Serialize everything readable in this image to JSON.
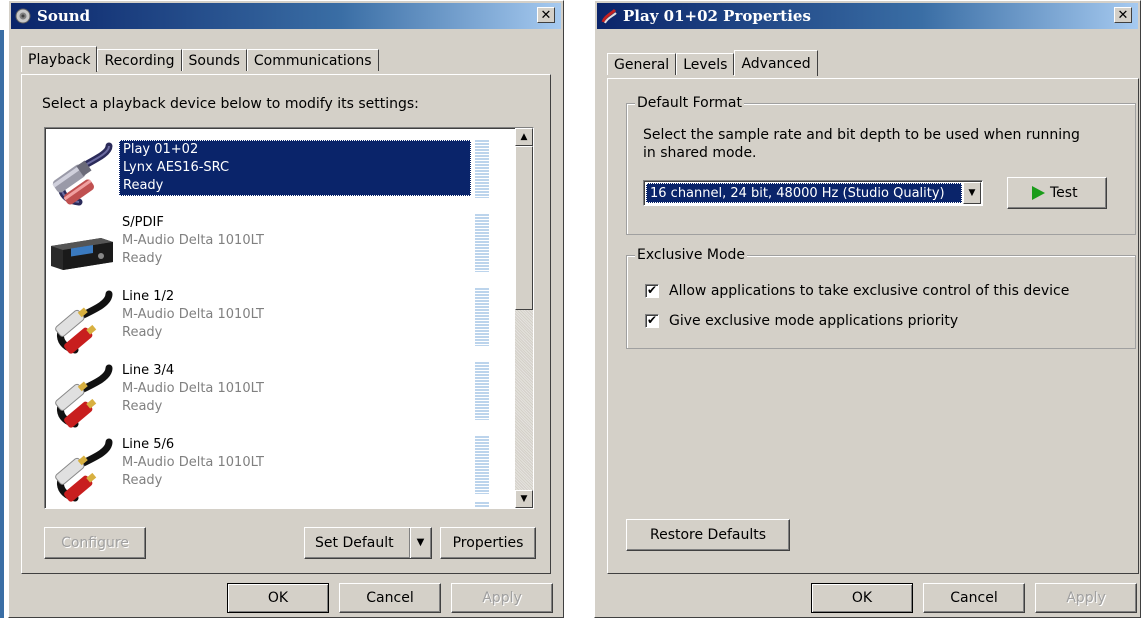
{
  "sound_dialog": {
    "title": "Sound",
    "close_glyph": "✕",
    "tabs": [
      {
        "label": "Playback",
        "active": true
      },
      {
        "label": "Recording",
        "active": false
      },
      {
        "label": "Sounds",
        "active": false
      },
      {
        "label": "Communications",
        "active": false
      }
    ],
    "instruction": "Select a playback device below to modify its settings:",
    "devices": [
      {
        "name": "Play 01+02",
        "driver": "Lynx AES16-SRC",
        "status": "Ready",
        "icon": "xlr-cable-icon",
        "selected": true
      },
      {
        "name": "S/PDIF",
        "driver": "M-Audio Delta 1010LT",
        "status": "Ready",
        "icon": "digital-receiver-icon",
        "selected": false
      },
      {
        "name": "Line 1/2",
        "driver": "M-Audio Delta 1010LT",
        "status": "Ready",
        "icon": "rca-cable-icon",
        "selected": false
      },
      {
        "name": "Line 3/4",
        "driver": "M-Audio Delta 1010LT",
        "status": "Ready",
        "icon": "rca-cable-icon",
        "selected": false
      },
      {
        "name": "Line 5/6",
        "driver": "M-Audio Delta 1010LT",
        "status": "Ready",
        "icon": "rca-cable-icon",
        "selected": false
      }
    ],
    "scroll_up_glyph": "▲",
    "scroll_down_glyph": "▼",
    "configure_label": "Configure",
    "set_default_label": "Set Default",
    "set_default_arrow": "▼",
    "properties_label": "Properties",
    "ok_label": "OK",
    "cancel_label": "Cancel",
    "apply_label": "Apply"
  },
  "properties_dialog": {
    "title": "Play 01+02 Properties",
    "close_glyph": "✕",
    "tabs": [
      {
        "label": "General",
        "active": false
      },
      {
        "label": "Levels",
        "active": false
      },
      {
        "label": "Advanced",
        "active": true
      }
    ],
    "default_format": {
      "group_label": "Default Format",
      "description_line1": "Select the sample rate and bit depth to be used when running",
      "description_line2": "in shared mode.",
      "selected_format": "16 channel, 24 bit, 48000 Hz (Studio Quality)",
      "combo_arrow": "▼",
      "test_label": "Test",
      "test_icon_color": "#1a9c1a"
    },
    "exclusive_mode": {
      "group_label": "Exclusive Mode",
      "allow_exclusive_label": "Allow applications to take exclusive control of this device",
      "allow_exclusive_checked": true,
      "priority_label": "Give exclusive mode applications priority",
      "priority_checked": true,
      "check_glyph": "✔"
    },
    "restore_defaults_label": "Restore Defaults",
    "ok_label": "OK",
    "cancel_label": "Cancel",
    "apply_label": "Apply"
  },
  "colors": {
    "titlebar_start": "#0a246a",
    "selection": "#0a246a",
    "dialog_face": "#d4d0c8",
    "meter": "#bcd4ec"
  }
}
